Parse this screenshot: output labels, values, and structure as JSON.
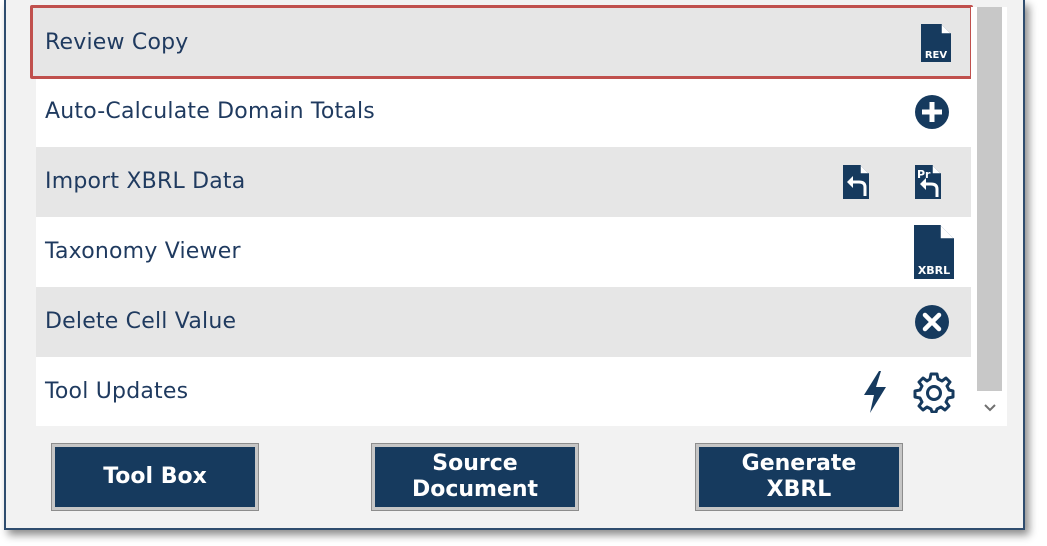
{
  "list": {
    "items": [
      {
        "label": "Review Copy",
        "selected": true,
        "icons": [
          "review-copy-icon"
        ]
      },
      {
        "label": "Auto-Calculate Domain Totals",
        "icons": [
          "plus-circle-icon"
        ]
      },
      {
        "label": "Import XBRL Data",
        "icons": [
          "import-file-icon",
          "import-pr-file-icon"
        ]
      },
      {
        "label": "Taxonomy Viewer",
        "icons": [
          "xbrl-file-icon"
        ]
      },
      {
        "label": "Delete Cell Value",
        "icons": [
          "close-circle-icon"
        ]
      },
      {
        "label": "Tool Updates",
        "icons": [
          "lightning-icon",
          "gear-icon"
        ]
      }
    ],
    "icon_text": {
      "rev": "REV",
      "pr": "Pr",
      "xbrl": "XBRL"
    }
  },
  "buttons": {
    "tool_box": {
      "line1": "Tool Box"
    },
    "source_document": {
      "line1": "Source",
      "line2": "Document"
    },
    "generate_xbrl": {
      "line1": "Generate",
      "line2": "XBRL"
    }
  },
  "colors": {
    "accent": "#163a5e",
    "selection_border": "#c0504d",
    "row_shade": "#e6e6e6",
    "label_text": "#1f3a5f"
  }
}
